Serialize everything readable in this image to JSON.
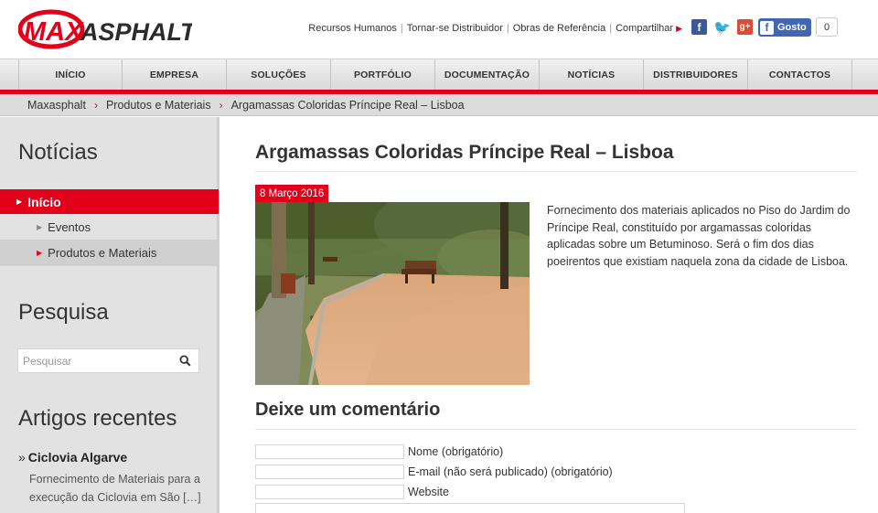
{
  "brand": {
    "logo_max": "MAX",
    "logo_asphalt": "ASPHALT",
    "accent_color": "#e3001b"
  },
  "toplinks": [
    "Recursos Humanos",
    "Tornar-se Distribuidor",
    "Obras de Referência",
    "Compartilhar"
  ],
  "social": {
    "facebook_icon": "facebook-icon",
    "twitter_icon": "twitter-icon",
    "googleplus_icon": "googleplus-icon",
    "like_label": "Gosto",
    "like_count": "0"
  },
  "nav": [
    "INÍCIO",
    "EMPRESA",
    "SOLUÇÕES",
    "PORTFÓLIO",
    "DOCUMENTAÇÃO",
    "NOTÍCIAS",
    "DISTRIBUIDORES",
    "CONTACTOS"
  ],
  "breadcrumb": [
    "Maxasphalt",
    "Produtos e Materiais",
    "Argamassas Coloridas Príncipe Real – Lisboa"
  ],
  "sidebar": {
    "news_heading": "Notícias",
    "items": [
      {
        "label": "Início"
      },
      {
        "label": "Eventos"
      },
      {
        "label": "Produtos e Materiais"
      }
    ],
    "search_heading": "Pesquisa",
    "search_placeholder": "Pesquisar",
    "recent_heading": "Artigos recentes",
    "recent_article_title": "Ciclovia Algarve",
    "recent_article_excerpt": "Fornecimento de Materiais para a execução da Ciclovia em São […]"
  },
  "post": {
    "title": "Argamassas Coloridas Príncipe Real – Lisboa",
    "date": "8 Março 2016",
    "description": "Fornecimento dos materiais aplicados no Piso do Jardim do Príncipe Real, constituído por argamassas coloridas aplicadas sobre um Betuminoso. Será o fim dos dias poeirentos que existiam naquela zona da cidade de Lisboa."
  },
  "comment_form": {
    "heading": "Deixe um comentário",
    "name_label": "Nome (obrigatório)",
    "email_label": "E-mail (não será publicado) (obrigatório)",
    "website_label": "Website"
  }
}
